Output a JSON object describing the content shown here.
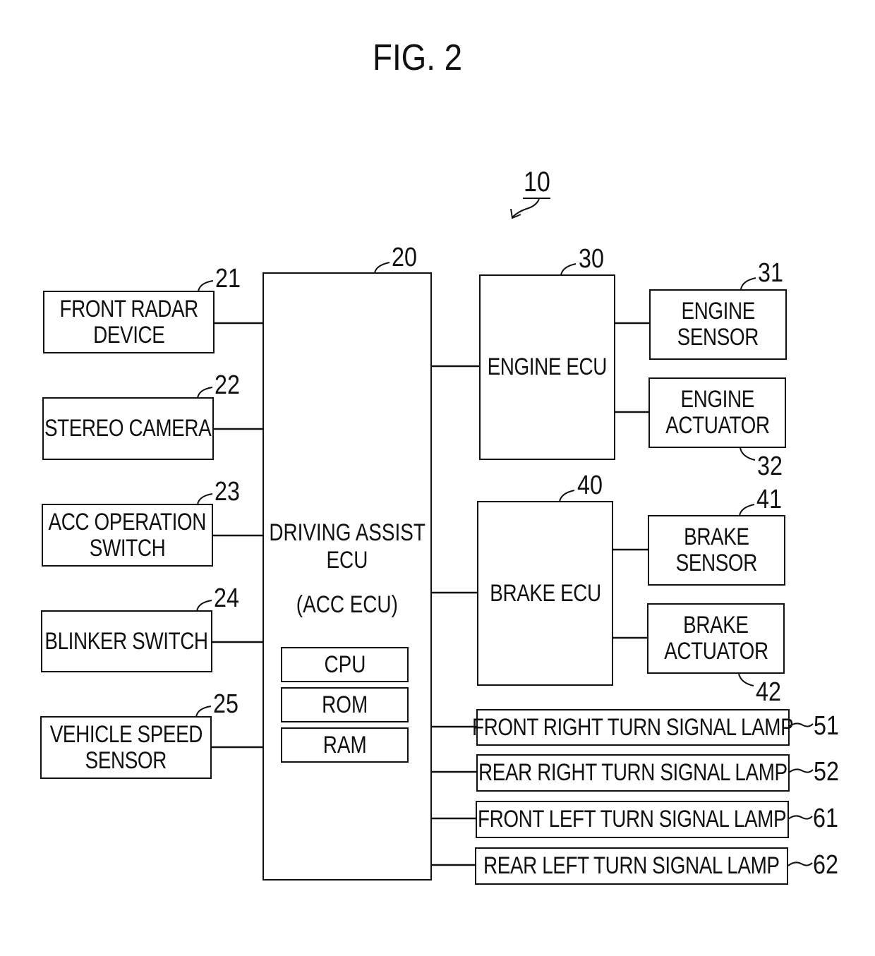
{
  "figure": {
    "title": "FIG. 2",
    "system_ref": "10"
  },
  "main_ecu": {
    "ref": "20",
    "title_line1": "DRIVING ASSIST",
    "title_line2": "ECU",
    "subtitle": "(ACC  ECU)",
    "components": [
      "CPU",
      "ROM",
      "RAM"
    ]
  },
  "inputs": [
    {
      "ref": "21",
      "lines": [
        "FRONT RADAR",
        "DEVICE"
      ]
    },
    {
      "ref": "22",
      "lines": [
        "STEREO CAMERA"
      ]
    },
    {
      "ref": "23",
      "lines": [
        "ACC OPERATION",
        "SWITCH"
      ]
    },
    {
      "ref": "24",
      "lines": [
        "BLINKER SWITCH"
      ]
    },
    {
      "ref": "25",
      "lines": [
        "VEHICLE SPEED",
        "SENSOR"
      ]
    }
  ],
  "engine_ecu": {
    "ref": "30",
    "label": "ENGINE ECU"
  },
  "engine_sensor": {
    "ref": "31",
    "lines": [
      "ENGINE",
      "SENSOR"
    ]
  },
  "engine_actuator": {
    "ref": "32",
    "lines": [
      "ENGINE",
      "ACTUATOR"
    ]
  },
  "brake_ecu": {
    "ref": "40",
    "label": "BRAKE ECU"
  },
  "brake_sensor": {
    "ref": "41",
    "lines": [
      "BRAKE",
      "SENSOR"
    ]
  },
  "brake_actuator": {
    "ref": "42",
    "lines": [
      "BRAKE",
      "ACTUATOR"
    ]
  },
  "lamps": [
    {
      "ref": "51",
      "label": "FRONT RIGHT TURN SIGNAL LAMP"
    },
    {
      "ref": "52",
      "label": "REAR RIGHT TURN SIGNAL LAMP"
    },
    {
      "ref": "61",
      "label": "FRONT LEFT TURN SIGNAL LAMP"
    },
    {
      "ref": "62",
      "label": "REAR LEFT TURN SIGNAL LAMP"
    }
  ]
}
